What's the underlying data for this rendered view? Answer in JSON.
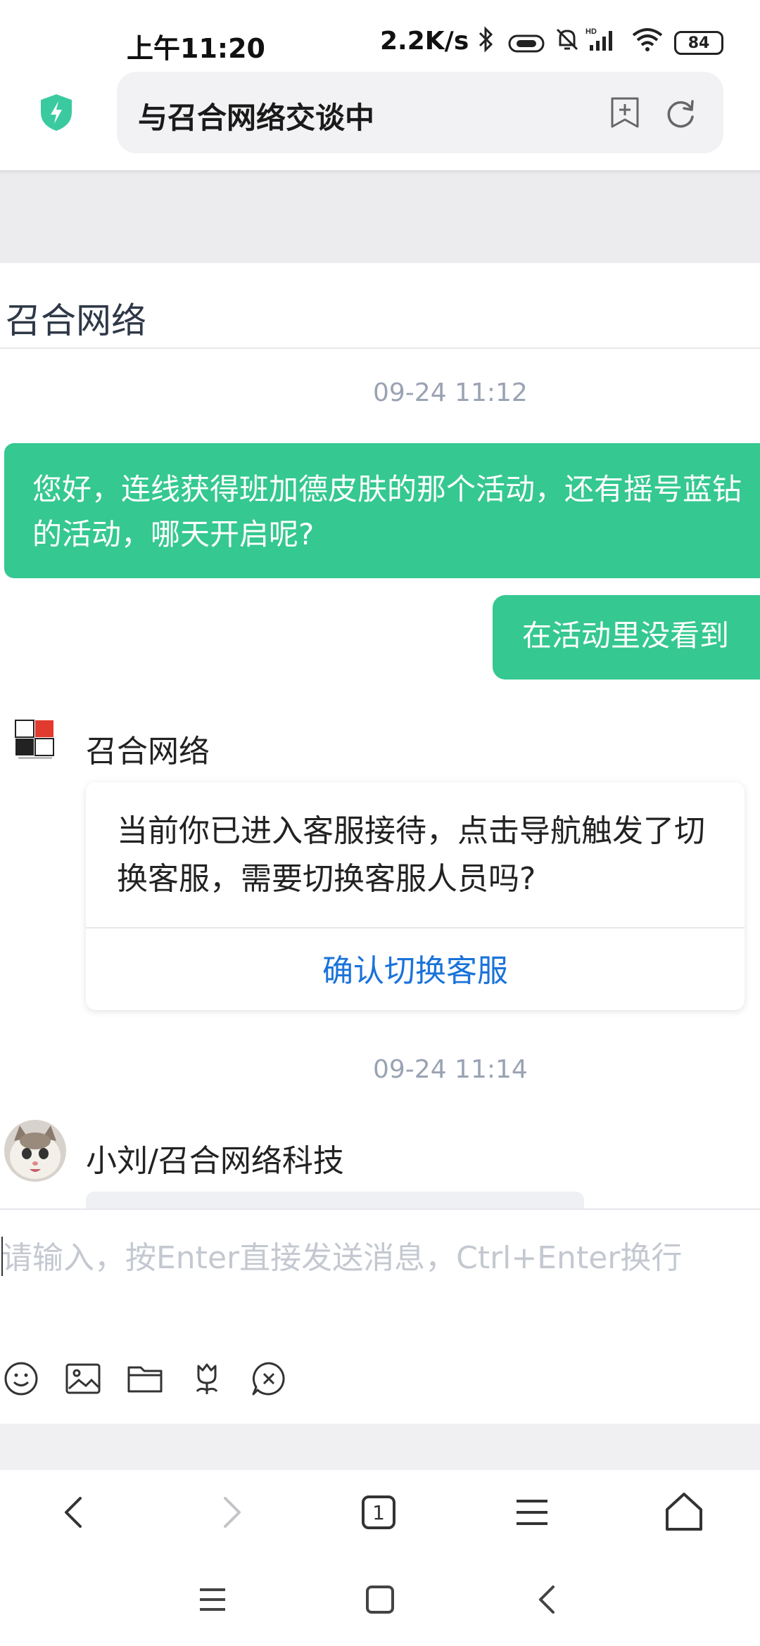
{
  "status_bar": {
    "time": "上午11:20",
    "net_speed": "2.2K/s",
    "battery": "84"
  },
  "browser": {
    "page_title": "与召合网络交谈中"
  },
  "chat": {
    "title": "召合网络",
    "messages": [
      {
        "timestamp": "09-24 11:12"
      },
      {
        "text": "您好，连线获得班加德皮肤的那个活动，还有摇号蓝钻的活动，哪天开启呢?"
      },
      {
        "text": "在活动里没看到"
      }
    ],
    "bot": {
      "sender": "召合网络",
      "card_text": "当前你已进入客服接待，点击导航触发了切换客服，需要切换客服人员吗?",
      "card_action": "确认切换客服"
    },
    "timestamp2": "09-24 11:14",
    "agent_sender": "小刘/召合网络科技"
  },
  "composer": {
    "placeholder": "请输入，按Enter直接发送消息，Ctrl+Enter换行"
  },
  "browser_nav": {
    "tab_count": "1"
  },
  "colors": {
    "accent_green": "#35c891",
    "link_blue": "#1a73d9"
  }
}
